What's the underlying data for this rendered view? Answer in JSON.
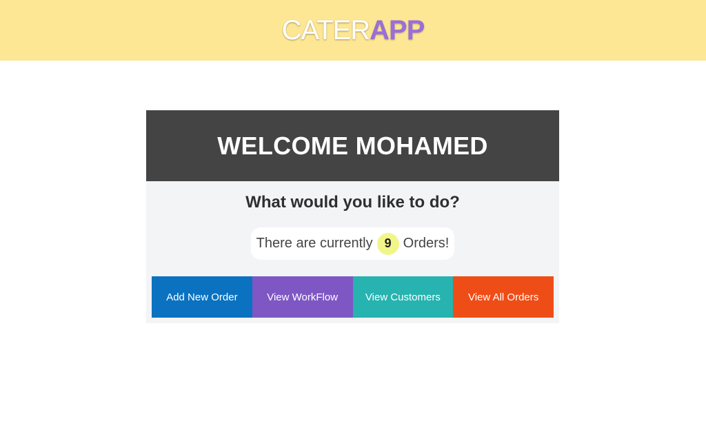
{
  "header": {
    "logo_light": "CATER",
    "logo_bold": "APP"
  },
  "card": {
    "welcome": "WELCOME MOHAMED",
    "prompt": "What would you like to do?",
    "orders_prefix": "There are currently",
    "orders_count": "9",
    "orders_suffix": "Orders!"
  },
  "actions": [
    {
      "label": "Add New Order",
      "color": "#0a72c0"
    },
    {
      "label": "View WorkFlow",
      "color": "#7f57c4"
    },
    {
      "label": "View Customers",
      "color": "#27b3b0"
    },
    {
      "label": "View All Orders",
      "color": "#ef4d17"
    }
  ],
  "colors": {
    "header_bg": "#fde694",
    "logo_accent": "#9a6fd6",
    "card_header_bg": "#444444",
    "count_badge": "#f2f58a"
  }
}
